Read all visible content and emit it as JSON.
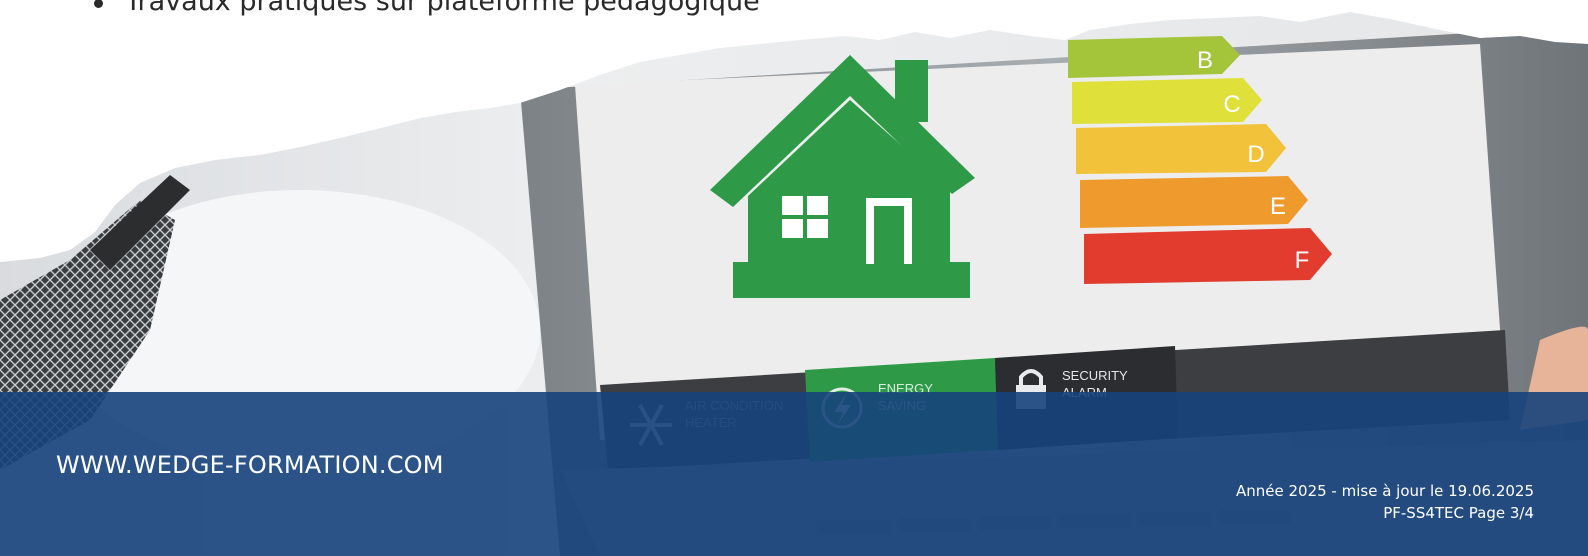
{
  "content": {
    "bullet_item": "Travaux pratiques sur plateforme pédagogique"
  },
  "screen": {
    "energy_grades": [
      "B",
      "C",
      "D",
      "E",
      "F"
    ],
    "menu": [
      {
        "icon": "snowflake-icon",
        "line1": "AIR CONDITION",
        "line2": "HEATER"
      },
      {
        "icon": "lightning-icon",
        "line1": "ENERGY",
        "line2": "SAVING"
      },
      {
        "icon": "lock-icon",
        "line1": "SECURITY",
        "line2": "ALARM"
      }
    ]
  },
  "footer": {
    "website": "WWW.WEDGE-FORMATION.COM",
    "year_update": "Année 2025 - mise à jour le 19.06.2025",
    "page_ref": "PF-SS4TEC Page 3/4"
  },
  "colors": {
    "footer_band": "#17427c",
    "house_green": "#2e9a48",
    "grade_colors": [
      "#a4c43a",
      "#dfe03a",
      "#f2c23a",
      "#ef9a2c",
      "#e23c2f"
    ]
  }
}
